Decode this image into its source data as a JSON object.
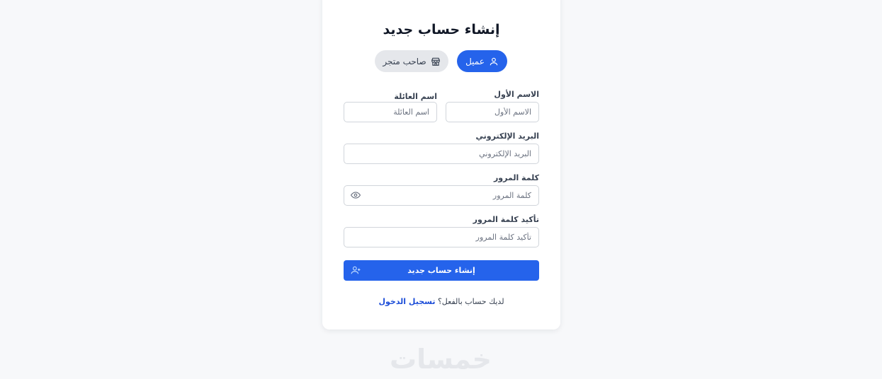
{
  "form": {
    "title": "إنشاء حساب جديد",
    "roles": {
      "customer_label": "عميل",
      "customer_icon": "user-icon",
      "merchant_label": "صاحب متجر",
      "merchant_icon": "store-icon"
    },
    "first_name": {
      "label": "الاسم الأول",
      "placeholder": "الاسم الأول"
    },
    "last_name": {
      "label": "اسم العائلة",
      "placeholder": "اسم العائلة"
    },
    "email": {
      "label": "البريد الإلكتروني",
      "placeholder": "البريد الإلكتروني"
    },
    "password": {
      "label": "كلمة المرور",
      "placeholder": "كلمة المرور",
      "toggle_icon": "eye-icon"
    },
    "confirm_password": {
      "label": "تأكيد كلمة المرور",
      "placeholder": "تأكيد كلمة المرور"
    },
    "submit_label": "إنشاء حساب جديد",
    "submit_icon": "user-plus-icon",
    "footer_text": "لديك حساب بالفعل؟",
    "login_link": "تسجيل الدخول"
  },
  "logo_text": "خمسات",
  "colors": {
    "primary": "#2563eb",
    "background": "#f7f8fa",
    "card": "#ffffff",
    "border": "#d1d5db"
  }
}
